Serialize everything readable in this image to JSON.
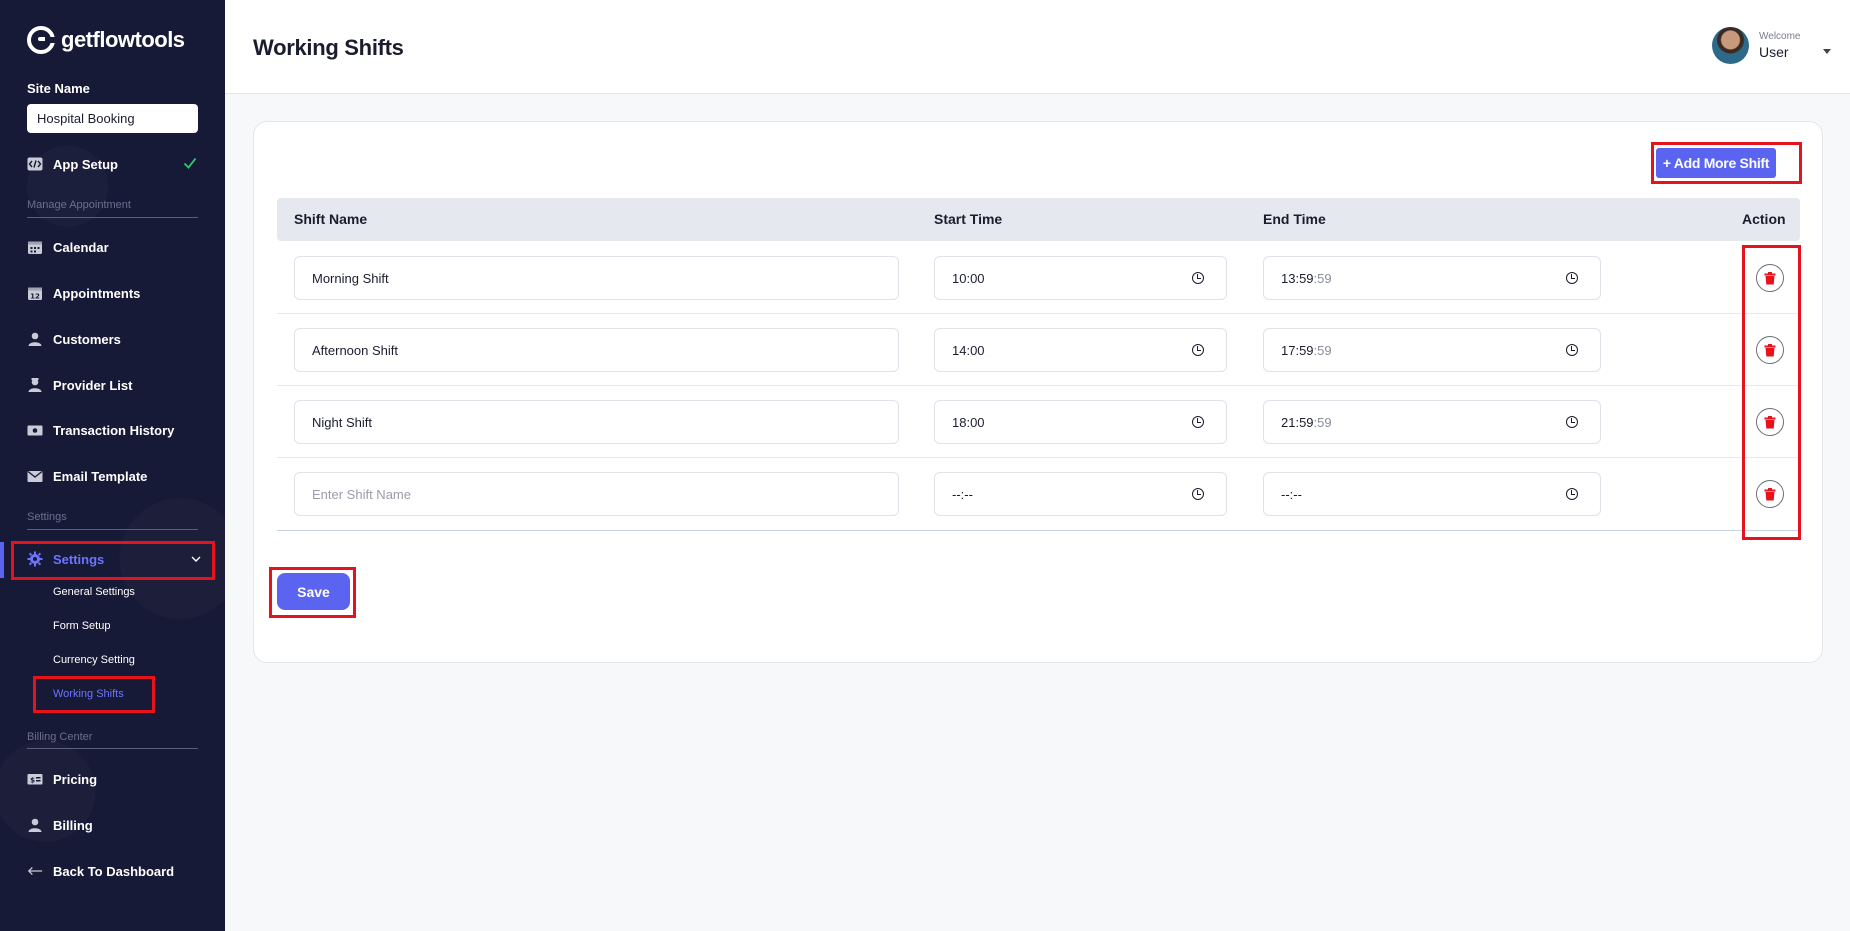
{
  "brand": {
    "name": "getflowtools"
  },
  "sidebar": {
    "site_name_label": "Site Name",
    "site_name_value": "Hospital Booking",
    "app_setup": "App Setup",
    "section_manage": "Manage Appointment",
    "items": [
      {
        "label": "Calendar",
        "icon": "calendar-icon"
      },
      {
        "label": "Appointments",
        "icon": "appointments-icon"
      },
      {
        "label": "Customers",
        "icon": "user-icon"
      },
      {
        "label": "Provider List",
        "icon": "provider-icon"
      },
      {
        "label": "Transaction History",
        "icon": "money-icon"
      },
      {
        "label": "Email Template",
        "icon": "mail-icon"
      }
    ],
    "section_settings": "Settings",
    "settings_label": "Settings",
    "settings_sub": [
      "General Settings",
      "Form Setup",
      "Currency Setting",
      "Working Shifts"
    ],
    "section_billing": "Billing Center",
    "billing_items": [
      {
        "label": "Pricing",
        "icon": "pricing-icon"
      },
      {
        "label": "Billing",
        "icon": "user-icon"
      }
    ],
    "back_label": "Back To Dashboard"
  },
  "header": {
    "title": "Working Shifts",
    "welcome": "Welcome",
    "user": "User"
  },
  "shifts": {
    "add_label": "+ Add More Shift",
    "columns": [
      "Shift Name",
      "Start Time",
      "End Time",
      "Action"
    ],
    "rows": [
      {
        "name": "Morning Shift",
        "start": "10:00",
        "end_hm": "13:59",
        "end_sec": ":59"
      },
      {
        "name": "Afternoon Shift",
        "start": "14:00",
        "end_hm": "17:59",
        "end_sec": ":59"
      },
      {
        "name": "Night Shift",
        "start": "18:00",
        "end_hm": "21:59",
        "end_sec": ":59"
      }
    ],
    "new_row": {
      "name_placeholder": "Enter Shift Name",
      "start_placeholder": "--:--",
      "end_placeholder": "--:--"
    },
    "save_label": "Save"
  },
  "colors": {
    "accent": "#5b64f0",
    "sidebar_bg": "#171a36",
    "delete": "#e6121d",
    "success": "#2ecc71"
  }
}
